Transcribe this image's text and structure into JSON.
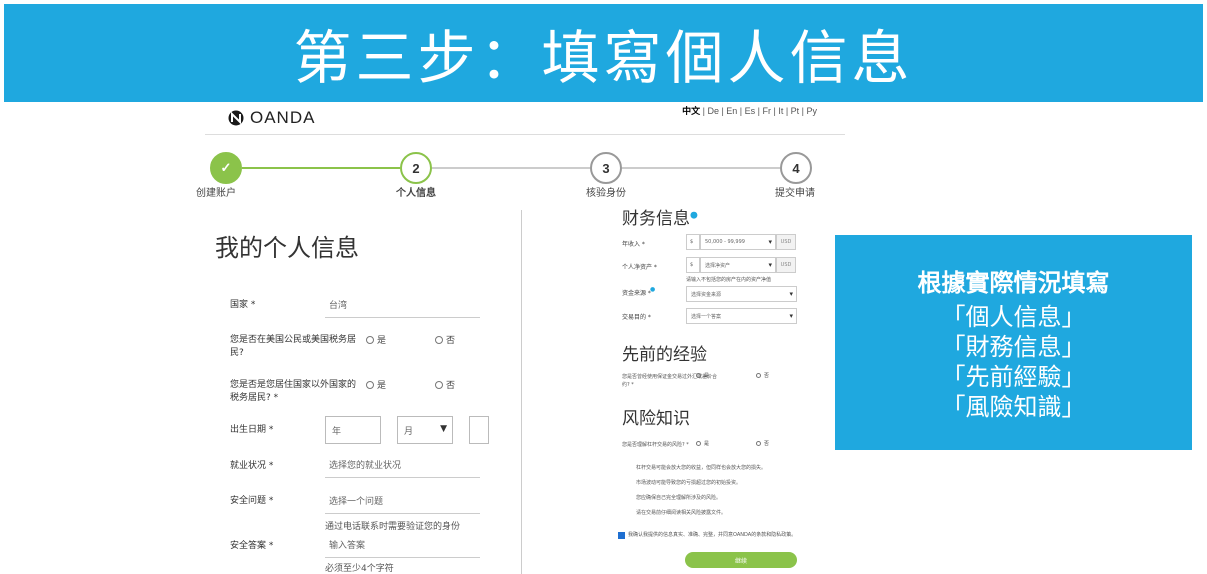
{
  "banner": {
    "title": "第三步：填寫個人信息"
  },
  "header": {
    "brand": "OANDA",
    "lang_current": "中文",
    "lang_others": " | De | En | Es | Fr | It | Pt | Ру"
  },
  "stepper": {
    "steps": [
      {
        "num": "✓",
        "label": "创建账户"
      },
      {
        "num": "2",
        "label": "个人信息"
      },
      {
        "num": "3",
        "label": "核验身份"
      },
      {
        "num": "4",
        "label": "提交申请"
      }
    ],
    "colors": {
      "done": "#8bc34a",
      "active": "#8bc34a",
      "pending": "#999999"
    }
  },
  "personal": {
    "title": "我的个人信息",
    "country_label": "国家 *",
    "country_value": "台湾",
    "q1_label": "您是否在美国公民或美国税务居民?",
    "q1_yes": "是",
    "q1_no": "否",
    "q2_label": "您是否是您居住国家以外国家的税务居民? *",
    "q2_yes": "是",
    "q2_no": "否",
    "dob_label": "出生日期 *",
    "dob_year": "年",
    "dob_month": "月",
    "employment_label": "就业状况 *",
    "employment_value": "选择您的就业状况",
    "security_q_label": "安全问题 *",
    "security_q_value": "选择一个问题",
    "security_hint": "通过电话联系时需要验证您的身份",
    "security_a_label": "安全答案 *",
    "security_a_placeholder": "输入答案",
    "security_a_hint": "必须至少4个字符"
  },
  "finance": {
    "title": "财务信息",
    "income_label": "年收入 *",
    "income_currency": "$",
    "income_value": "50,000 - 99,999",
    "income_unit": "USD",
    "networth_label": "个人净资产 *",
    "networth_currency": "$",
    "networth_value": "选择净资产",
    "networth_unit": "USD",
    "networth_hint": "请输入不包括您的房产在内的资产净值",
    "source_label": "资金来源 *",
    "source_value": "选择资金来源",
    "purpose_label": "交易目的 *",
    "purpose_value": "选择一个答案"
  },
  "experience": {
    "title": "先前的经验",
    "q_label": "您是否曾经使用保证金交易过外汇或差价合约? *",
    "yes": "是",
    "no": "否"
  },
  "risk": {
    "title": "风险知识",
    "q_label": "您是否理解杠杆交易的风险? *",
    "yes": "是",
    "no": "否",
    "bullets": [
      "杠杆交易可能会放大您的收益，但同样也会放大您的损失。",
      "市场波动可能导致您的亏损超过您的初始投资。",
      "您应确保自己完全理解所涉及的风险。",
      "请在交易前仔细阅读相关风险披露文件。"
    ],
    "consent": "我确认我提供的信息真实、准确、完整，并同意OANDA的条款和隐私政策。",
    "submit": "继续"
  },
  "info_box": {
    "heading": "根據實際情況填寫",
    "items": [
      "「個人信息」",
      "「財務信息」",
      "「先前經驗」",
      "「風險知識」"
    ]
  }
}
